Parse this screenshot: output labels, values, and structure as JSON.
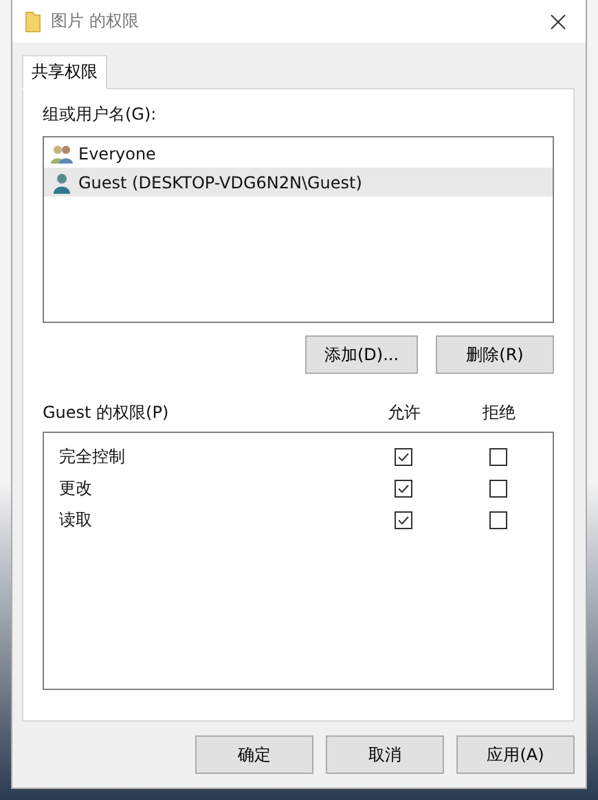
{
  "window": {
    "title": "图片 的权限"
  },
  "tabs": [
    {
      "label": "共享权限",
      "selected": true
    }
  ],
  "group_list": {
    "label": "组或用户名(G):",
    "items": [
      {
        "name": "Everyone",
        "kind": "group",
        "selected": false
      },
      {
        "name": "Guest (DESKTOP-VDG6N2N\\Guest)",
        "kind": "user",
        "selected": true
      }
    ]
  },
  "list_buttons": [
    "添加(D)...",
    "删除(R)"
  ],
  "permissions": {
    "label": "Guest 的权限(P)",
    "columns": [
      "允许",
      "拒绝"
    ],
    "rows": [
      {
        "name": "完全控制",
        "allow": true,
        "deny": false
      },
      {
        "name": "更改",
        "allow": true,
        "deny": false
      },
      {
        "name": "读取",
        "allow": true,
        "deny": false
      }
    ]
  },
  "buttons": [
    "确定",
    "取消",
    "应用(A)"
  ]
}
